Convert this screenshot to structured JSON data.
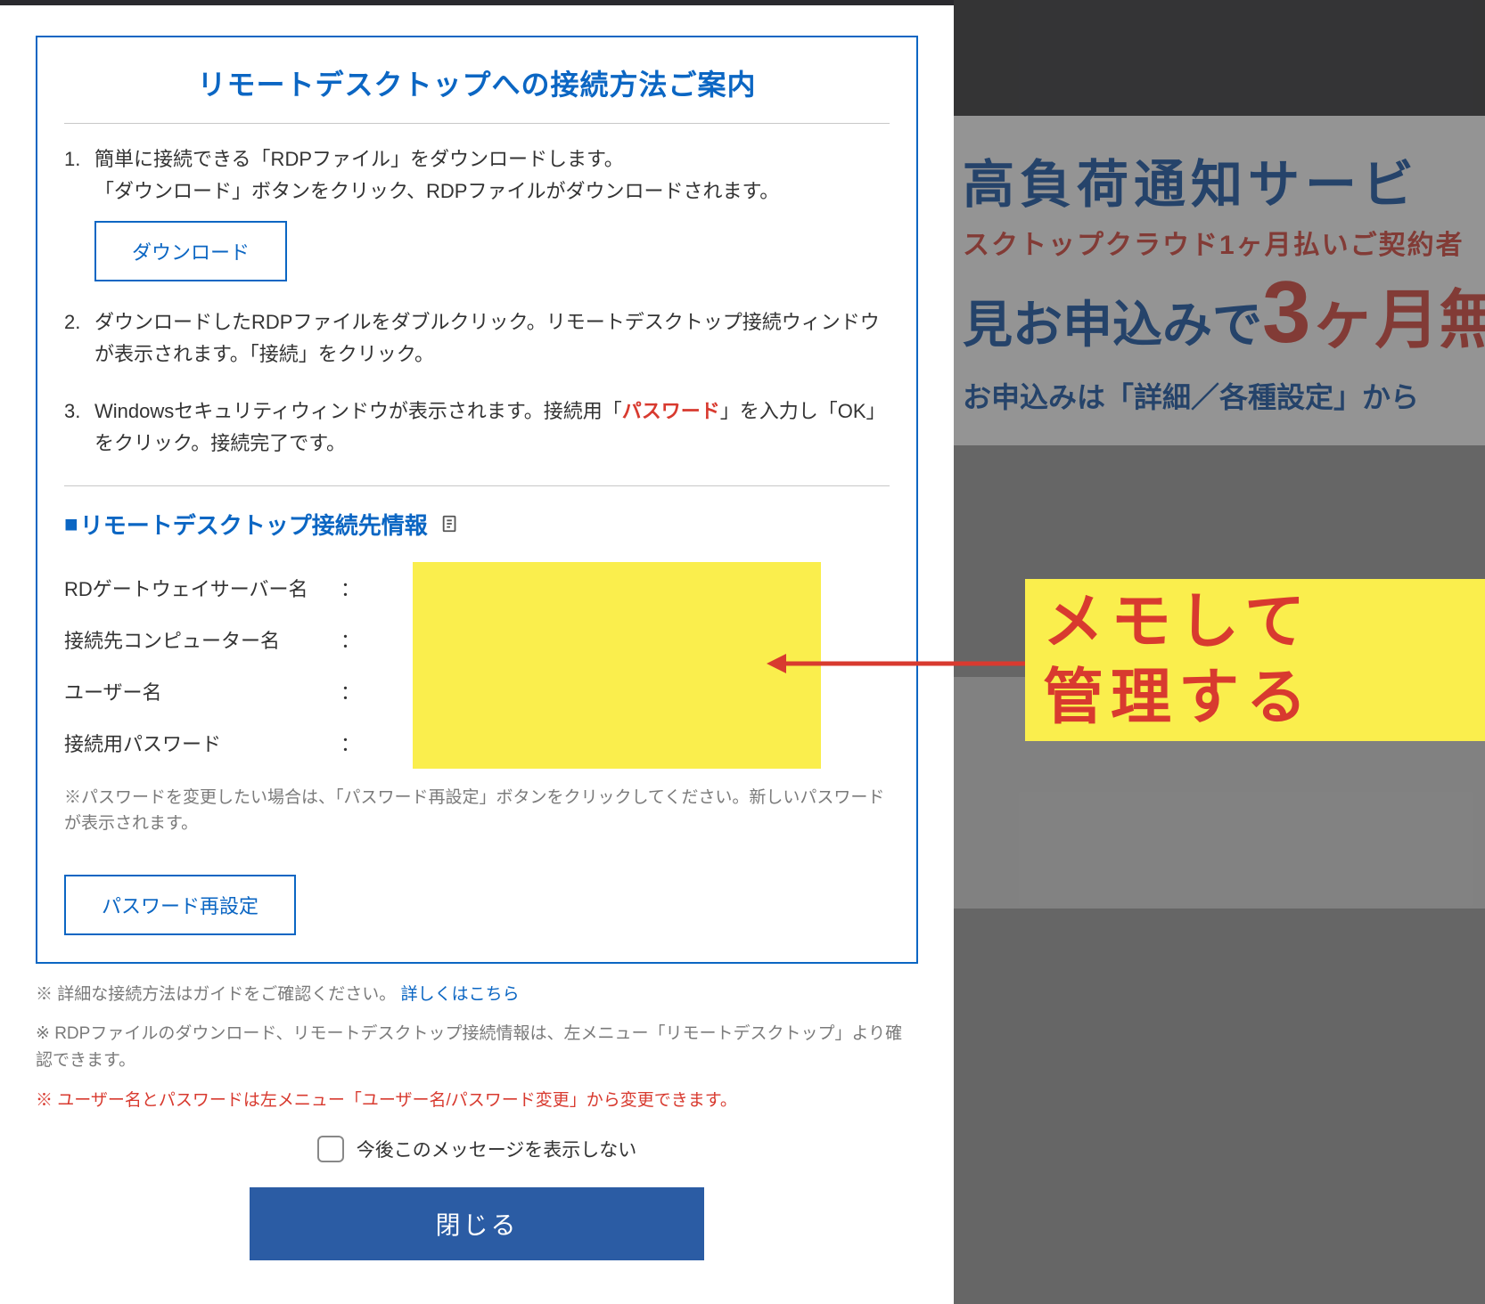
{
  "modal": {
    "title": "リモートデスクトップへの接続方法ご案内",
    "steps": [
      {
        "line1": "簡単に接続できる「RDPファイル」をダウンロードします。",
        "line2": "「ダウンロード」ボタンをクリック、RDPファイルがダウンロードされます。",
        "button": "ダウンロード"
      },
      {
        "line1": "ダウンロードしたRDPファイルをダブルクリック。リモートデスクトップ接続ウィンドウが表示されます。「接続」をクリック。"
      },
      {
        "pre": "Windowsセキュリティウィンドウが表示されます。接続用「",
        "emph": "パスワード",
        "post": "」を入力し「OK」をクリック。接続完了です。"
      }
    ],
    "section_title": "リモートデスクトップ接続先情報",
    "info_rows": [
      {
        "label": "RDゲートウェイサーバー名"
      },
      {
        "label": "接続先コンピューター名"
      },
      {
        "label": "ユーザー名"
      },
      {
        "label": "接続用パスワード"
      }
    ],
    "colon": "：",
    "note_grey": "※パスワードを変更したい場合は、「パスワード再設定」ボタンをクリックしてください。新しいパスワードが表示されます。",
    "btn_reset": "パスワード再設定",
    "footer": {
      "note1_pre": "※ 詳細な接続方法はガイドをご確認ください。 ",
      "note1_link": "詳しくはこちら",
      "note2": "※ RDPファイルのダウンロード、リモートデスクトップ接続情報は、左メニュー「リモートデスクトップ」より確認できます。",
      "note3": "※ ユーザー名とパスワードは左メニュー「ユーザー名/パスワード変更」から変更できます。"
    },
    "checkbox_label": "今後このメッセージを表示しない",
    "btn_close": "閉じる"
  },
  "callout": {
    "line1": "メモして",
    "line2": "管理する"
  },
  "background_banner": {
    "line1": "高負荷通知サービ",
    "line2": "スクトップクラウド1ヶ月払いご契約者",
    "line3_pre": "見お申込みで",
    "line3_num": "3",
    "line3_post": "ヶ月無",
    "line4": "お申込みは「詳細／各種設定」から"
  }
}
